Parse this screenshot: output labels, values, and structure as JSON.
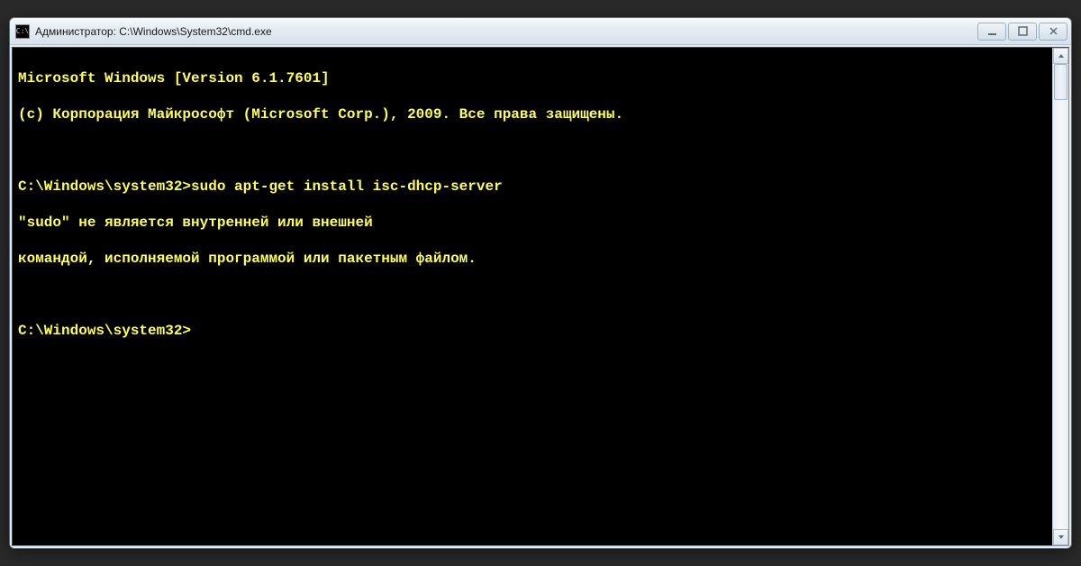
{
  "window": {
    "title": "Администратор: C:\\Windows\\System32\\cmd.exe",
    "icon_label": "C:\\"
  },
  "terminal": {
    "version_line": "Microsoft Windows [Version 6.1.7601]",
    "copyright_line": "(c) Корпорация Майкрософт (Microsoft Corp.), 2009. Все права защищены.",
    "prompt1": "C:\\Windows\\system32>",
    "command1": "sudo apt-get install isc-dhcp-server",
    "error_line1": "\"sudo\" не является внутренней или внешней",
    "error_line2": "командой, исполняемой программой или пакетным файлом.",
    "prompt2": "C:\\Windows\\system32>"
  },
  "colors": {
    "terminal_bg": "#000000",
    "terminal_fg": "#ffff55",
    "chrome_bg": "#e3eaf2"
  }
}
